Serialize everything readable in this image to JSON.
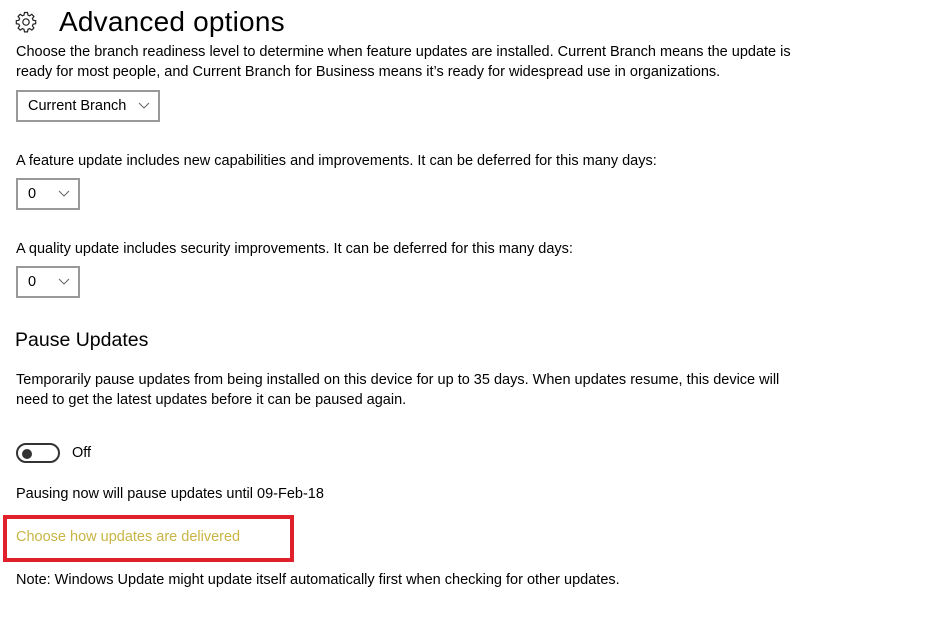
{
  "header": {
    "icon": "gear-icon",
    "title": "Advanced options"
  },
  "branch": {
    "description": "Choose the branch readiness level to determine when feature updates are installed. Current Branch means the update is ready for most people, and Current Branch for Business means it’s ready for widespread use in organizations.",
    "line1": "Choose the branch readiness level to determine when feature updates are installed. Current Branch means the update is",
    "line2": "ready for most people, and Current Branch for Business means it’s ready for widespread use in organizations.",
    "selected": "Current Branch"
  },
  "feature_update": {
    "label": "A feature update includes new capabilities and improvements. It can be deferred for this many days:",
    "selected": "0"
  },
  "quality_update": {
    "label": "A quality update includes security improvements. It can be deferred for this many days:",
    "selected": "0"
  },
  "pause": {
    "title": "Pause Updates",
    "line1": "Temporarily pause updates from being installed on this device for up to 35 days. When updates resume, this device will",
    "line2": "need to get the latest updates before it can be paused again.",
    "toggle_state": "Off",
    "until_text": "Pausing now will pause updates until 09-Feb-18"
  },
  "link": {
    "label": "Choose how updates are delivered",
    "color": "#c9b545",
    "highlight_color": "#e0202a"
  },
  "note": "Note: Windows Update might update itself automatically first when checking for other updates."
}
